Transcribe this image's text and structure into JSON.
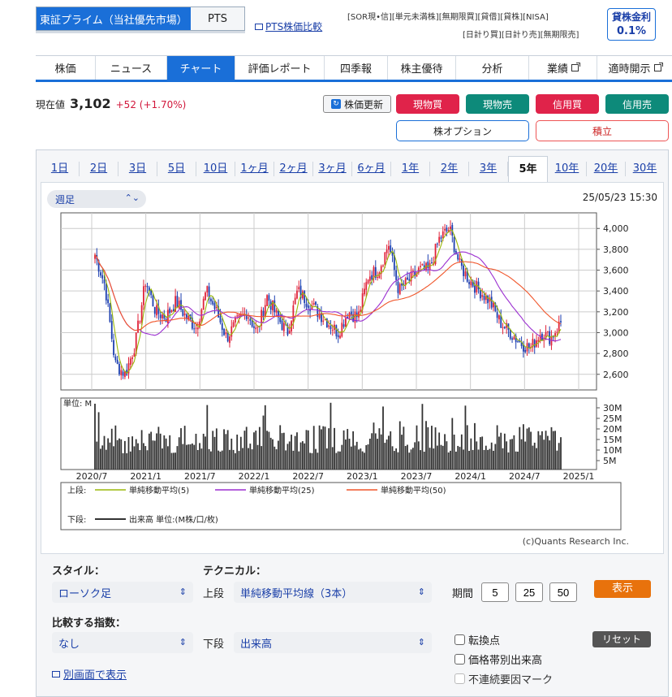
{
  "market": {
    "selected": "東証プライム（当社優先市場）",
    "other": "PTS"
  },
  "pts_compare": "PTS株価比較",
  "badges": {
    "row1": [
      "[SOR現•信]",
      "[単元未満株]",
      "[無期限買]",
      "[貸借]",
      "[貸株]",
      "[NISA]"
    ],
    "row2": [
      "[日計り買]",
      "[日計り売]",
      "[無期限売]"
    ]
  },
  "lending_rate": {
    "label": "貸株金利",
    "value": "0.1%"
  },
  "nav": {
    "tabs": [
      "株価",
      "ニュース",
      "チャート",
      "評価レポート",
      "四季報",
      "株主優待",
      "分析",
      "業績",
      "適時開示"
    ],
    "selected": 2
  },
  "price": {
    "label": "現在値",
    "value": "3,102",
    "change": "+52 (+1.70%)"
  },
  "buttons": {
    "refresh": "株価更新",
    "genbutsu_buy": "現物買",
    "genbutsu_sell": "現物売",
    "shinyo_buy": "信用買",
    "shinyo_sell": "信用売",
    "option": "株オプション",
    "tsumitate": "積立"
  },
  "periods": [
    "1日",
    "2日",
    "3日",
    "5日",
    "10日",
    "1ヶ月",
    "2ヶ月",
    "3ヶ月",
    "6ヶ月",
    "1年",
    "2年",
    "3年",
    "5年",
    "10年",
    "20年",
    "30年"
  ],
  "period_selected": 12,
  "frequency": "週足",
  "timestamp": "25/05/23 15:30",
  "chart_data": {
    "type": "candlestick",
    "y_ticks": [
      "4,000",
      "3,800",
      "3,600",
      "3,400",
      "3,200",
      "3,000",
      "2,800",
      "2,600"
    ],
    "ylim": [
      2450,
      4150
    ],
    "x_ticks": [
      "2020/7",
      "2021/1",
      "2021/7",
      "2022/1",
      "2022/7",
      "2023/1",
      "2023/7",
      "2024/1",
      "2024/7",
      "2025/1"
    ],
    "volume_unit": "単位: M",
    "volume_ticks": [
      "30M",
      "25M",
      "20M",
      "15M",
      "10M",
      "5M"
    ],
    "close_path": [
      3750,
      3450,
      2700,
      2600,
      2900,
      3500,
      3200,
      3150,
      3300,
      3150,
      3050,
      3400,
      3200,
      2950,
      3100,
      3200,
      3000,
      3350,
      3150,
      3000,
      3400,
      3300,
      3200,
      3100,
      3000,
      3200,
      3150,
      3550,
      3600,
      3850,
      3400,
      3500,
      3600,
      3600,
      3900,
      4000,
      3650,
      3500,
      3400,
      3300,
      3100,
      3000,
      2900,
      2850,
      3000,
      2950,
      3100
    ],
    "legend_upper_label": "上段:",
    "legend_lower_label": "下段:",
    "series": [
      {
        "name": "単純移動平均(5)",
        "color": "#9ab80a"
      },
      {
        "name": "単純移動平均(25)",
        "color": "#9b2fd0"
      },
      {
        "name": "単純移動平均(50)",
        "color": "#f0552a"
      }
    ],
    "volume_legend": "出来高 単位:(M株/口/枚)"
  },
  "credit": "(c)Quants Research Inc.",
  "controls": {
    "style_label": "スタイル：",
    "style_value": "ローソク足",
    "technical_label": "テクニカル：",
    "upper_label": "上段",
    "upper_value": "単純移動平均線（3本）",
    "period_label": "期間",
    "periods": [
      "5",
      "25",
      "50"
    ],
    "show": "表示",
    "compare_label": "比較する指数：",
    "compare_value": "なし",
    "lower_label": "下段",
    "lower_value": "出来高",
    "check_turn": "転換点",
    "check_volume_profile": "価格帯別出来高",
    "check_discontinuity": "不連続要因マーク",
    "reset": "リセット",
    "separate_window": "別画面で表示"
  }
}
